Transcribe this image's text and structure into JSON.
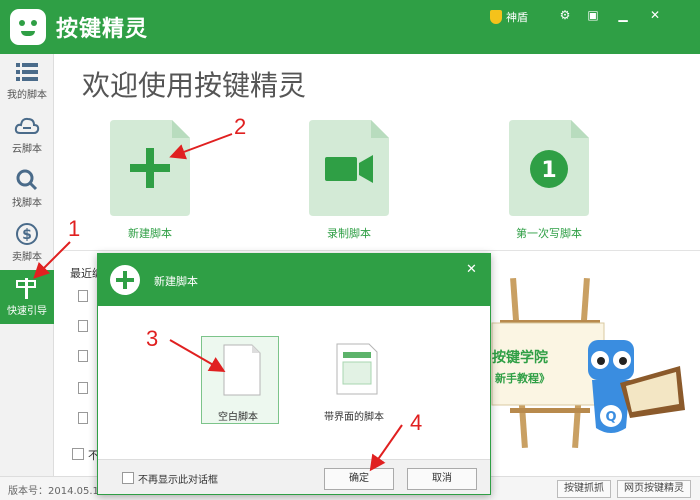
{
  "app": {
    "title": "按键精灵",
    "shield": "神盾",
    "icon": "robot-logo"
  },
  "titlebar_buttons": [
    "gear-icon",
    "restore-icon",
    "minimize-icon",
    "close-icon"
  ],
  "sidebar": {
    "items": [
      {
        "label": "我的脚本",
        "icon": "list-icon"
      },
      {
        "label": "云脚本",
        "icon": "cloud-icon"
      },
      {
        "label": "找脚本",
        "icon": "search-icon"
      },
      {
        "label": "卖脚本",
        "icon": "dollar-icon"
      },
      {
        "label": "快速引导",
        "icon": "signpost-icon",
        "active": true
      }
    ]
  },
  "main": {
    "welcome": "欢迎使用按键精灵",
    "cards": [
      {
        "label": "新建脚本",
        "icon": "plus-icon"
      },
      {
        "label": "录制脚本",
        "icon": "video-camera-icon"
      },
      {
        "label": "第一次写脚本",
        "icon": "number-one-icon"
      }
    ],
    "recent_title": "最近编",
    "recent_checkbox_label": "不"
  },
  "academy": {
    "title": "按键学院",
    "subtitle": "新手教程》"
  },
  "statusbar": {
    "version": "版本号：2014.05.17",
    "buttons": [
      "按键抓抓",
      "网页按键精灵"
    ]
  },
  "dialog": {
    "title": "新建脚本",
    "options": [
      {
        "label": "空白脚本",
        "icon": "blank-document-icon",
        "selected": true
      },
      {
        "label": "带界面的脚本",
        "icon": "form-document-icon",
        "selected": false
      }
    ],
    "dont_show_label": "不再显示此对话框",
    "ok_label": "确定",
    "cancel_label": "取消"
  },
  "annotations": [
    "1",
    "2",
    "3",
    "4"
  ],
  "colors": {
    "accent": "#2f9f45",
    "annotation": "#e02020"
  }
}
